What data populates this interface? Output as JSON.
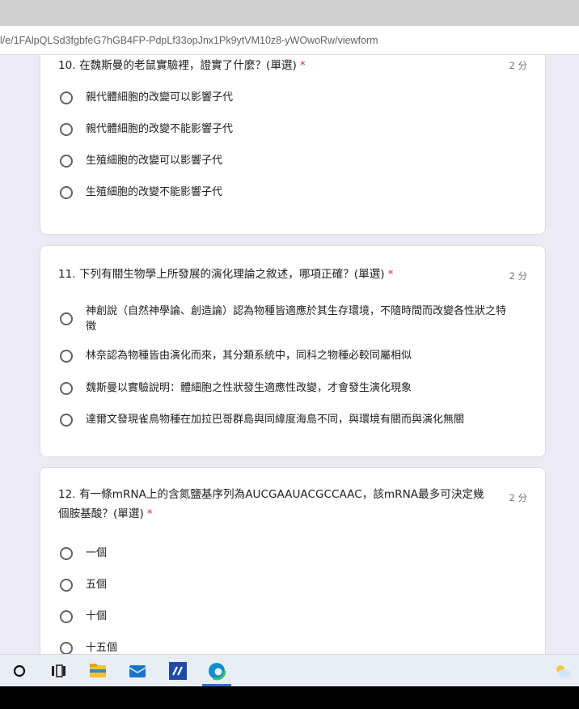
{
  "browser": {
    "url": "l/e/1FAlpQLSd3fgbfeG7hGB4FP-PdpLf33opJnx1Pk9ytVM10z8-yWOwoRw/viewform"
  },
  "questions": [
    {
      "title": "10. 在魏斯曼的老鼠實驗裡，證實了什麼？(單選)",
      "required": "*",
      "points": "2 分",
      "options": [
        "親代體細胞的改變可以影響子代",
        "親代體細胞的改變不能影響子代",
        "生殖細胞的改變可以影響子代",
        "生殖細胞的改變不能影響子代"
      ]
    },
    {
      "title": "11. 下列有關生物學上所發展的演化理論之敘述，哪項正確？(單選)",
      "required": "*",
      "points": "2 分",
      "options": [
        "神創說（自然神學論、創造論）認為物種皆適應於其生存環境，不隨時間而改變各性狀之特徵",
        "林奈認為物種皆由演化而來，其分類系統中，同科之物種必較同屬相似",
        "魏斯曼以實驗說明：體細胞之性狀發生適應性改變，才會發生演化現象",
        "達爾文發現雀鳥物種在加拉巴哥群島與同緯度海島不同，與環境有關而與演化無關"
      ]
    },
    {
      "title": "12. 有一條mRNA上的含氮鹽基序列為AUCGAAUACGCCAAC，該mRNA最多可決定幾個胺基酸？(單選)",
      "required": "*",
      "points": "2 分",
      "options": [
        "一個",
        "五個",
        "十個",
        "十五個"
      ]
    }
  ],
  "taskbar": {
    "icons": [
      "search-circle-icon",
      "task-view-icon",
      "file-explorer-icon",
      "mail-icon",
      "app-icon",
      "edge-icon",
      "weather-icon"
    ]
  }
}
